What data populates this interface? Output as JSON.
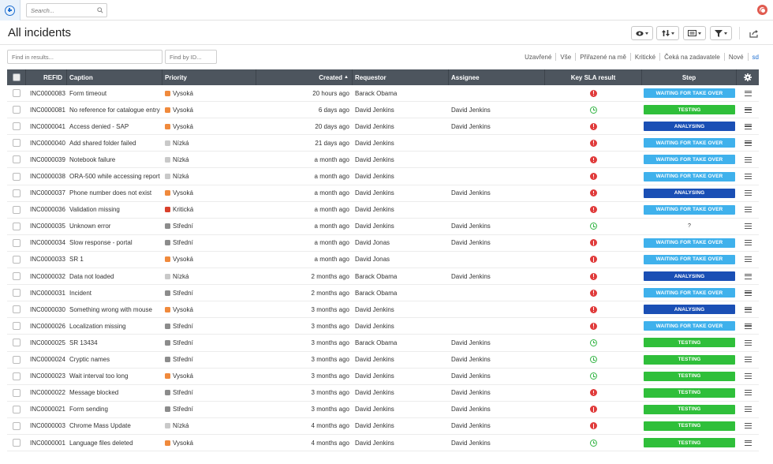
{
  "topbar": {
    "search_placeholder": "Search..."
  },
  "header": {
    "title": "All incidents"
  },
  "filters": {
    "find_results_placeholder": "Find in results...",
    "find_id_placeholder": "Find by ID...",
    "quick": [
      "Uzavřené",
      "Vše",
      "Přiřazené na mě",
      "Kritické",
      "Čeká na zadavatele",
      "Nové",
      "sd"
    ]
  },
  "table": {
    "columns": {
      "refid": "REFID",
      "caption": "Caption",
      "priority": "Priority",
      "created": "Created",
      "requestor": "Requestor",
      "assignee": "Assignee",
      "sla": "Key SLA result",
      "step": "Step"
    },
    "rows": [
      {
        "refid": "INC0000083",
        "caption": "Form timeout",
        "priority": "Vysoká",
        "created": "20 hours ago",
        "requestor": "Barack Obama",
        "assignee": "",
        "sla": "bad",
        "step": "WAITING FOR TAKE OVER"
      },
      {
        "refid": "INC0000081",
        "caption": "No reference for catalogue entry",
        "priority": "Vysoká",
        "created": "6 days ago",
        "requestor": "David Jenkins",
        "assignee": "David Jenkins",
        "sla": "ok",
        "step": "TESTING"
      },
      {
        "refid": "INC0000041",
        "caption": "Access denied - SAP",
        "priority": "Vysoká",
        "created": "20 days ago",
        "requestor": "David Jenkins",
        "assignee": "David Jenkins",
        "sla": "bad",
        "step": "ANALYSING"
      },
      {
        "refid": "INC0000040",
        "caption": "Add shared folder failed",
        "priority": "Nízká",
        "created": "21 days ago",
        "requestor": "David Jenkins",
        "assignee": "",
        "sla": "bad",
        "step": "WAITING FOR TAKE OVER"
      },
      {
        "refid": "INC0000039",
        "caption": "Notebook failure",
        "priority": "Nízká",
        "created": "a month ago",
        "requestor": "David Jenkins",
        "assignee": "",
        "sla": "bad",
        "step": "WAITING FOR TAKE OVER"
      },
      {
        "refid": "INC0000038",
        "caption": "ORA-500 while accessing report",
        "priority": "Nízká",
        "created": "a month ago",
        "requestor": "David Jenkins",
        "assignee": "",
        "sla": "bad",
        "step": "WAITING FOR TAKE OVER"
      },
      {
        "refid": "INC0000037",
        "caption": "Phone number does not exist",
        "priority": "Vysoká",
        "created": "a month ago",
        "requestor": "David Jenkins",
        "assignee": "David Jenkins",
        "sla": "bad",
        "step": "ANALYSING"
      },
      {
        "refid": "INC0000036",
        "caption": "Validation missing",
        "priority": "Kritická",
        "created": "a month ago",
        "requestor": "David Jenkins",
        "assignee": "",
        "sla": "bad",
        "step": "WAITING FOR TAKE OVER"
      },
      {
        "refid": "INC0000035",
        "caption": "Unknown error",
        "priority": "Střední",
        "created": "a month ago",
        "requestor": "David Jenkins",
        "assignee": "David Jenkins",
        "sla": "ok",
        "step": "?"
      },
      {
        "refid": "INC0000034",
        "caption": "Slow response - portal",
        "priority": "Střední",
        "created": "a month ago",
        "requestor": "David Jonas",
        "assignee": "David Jenkins",
        "sla": "bad",
        "step": "WAITING FOR TAKE OVER"
      },
      {
        "refid": "INC0000033",
        "caption": "SR 1",
        "priority": "Vysoká",
        "created": "a month ago",
        "requestor": "David Jonas",
        "assignee": "",
        "sla": "bad",
        "step": "WAITING FOR TAKE OVER"
      },
      {
        "refid": "INC0000032",
        "caption": "Data not loaded",
        "priority": "Nízká",
        "created": "2 months ago",
        "requestor": "Barack Obama",
        "assignee": "David Jenkins",
        "sla": "bad",
        "step": "ANALYSING"
      },
      {
        "refid": "INC0000031",
        "caption": "Incident",
        "priority": "Střední",
        "created": "2 months ago",
        "requestor": "Barack Obama",
        "assignee": "",
        "sla": "bad",
        "step": "WAITING FOR TAKE OVER"
      },
      {
        "refid": "INC0000030",
        "caption": "Something wrong with mouse",
        "priority": "Vysoká",
        "created": "3 months ago",
        "requestor": "David Jenkins",
        "assignee": "",
        "sla": "bad",
        "step": "ANALYSING"
      },
      {
        "refid": "INC0000026",
        "caption": "Localization missing",
        "priority": "Střední",
        "created": "3 months ago",
        "requestor": "David Jenkins",
        "assignee": "",
        "sla": "bad",
        "step": "WAITING FOR TAKE OVER"
      },
      {
        "refid": "INC0000025",
        "caption": "SR 13434",
        "priority": "Střední",
        "created": "3 months ago",
        "requestor": "Barack Obama",
        "assignee": "David Jenkins",
        "sla": "ok",
        "step": "TESTING"
      },
      {
        "refid": "INC0000024",
        "caption": "Cryptic names",
        "priority": "Střední",
        "created": "3 months ago",
        "requestor": "David Jenkins",
        "assignee": "David Jenkins",
        "sla": "ok",
        "step": "TESTING"
      },
      {
        "refid": "INC0000023",
        "caption": "Wait interval too long",
        "priority": "Vysoká",
        "created": "3 months ago",
        "requestor": "David Jenkins",
        "assignee": "David Jenkins",
        "sla": "ok",
        "step": "TESTING"
      },
      {
        "refid": "INC0000022",
        "caption": "Message blocked",
        "priority": "Střední",
        "created": "3 months ago",
        "requestor": "David Jenkins",
        "assignee": "David Jenkins",
        "sla": "bad",
        "step": "TESTING"
      },
      {
        "refid": "INC0000021",
        "caption": "Form sending",
        "priority": "Střední",
        "created": "3 months ago",
        "requestor": "David Jenkins",
        "assignee": "David Jenkins",
        "sla": "bad",
        "step": "TESTING"
      },
      {
        "refid": "INC0000003",
        "caption": "Chrome Mass Update",
        "priority": "Nízká",
        "created": "4 months ago",
        "requestor": "David Jenkins",
        "assignee": "David Jenkins",
        "sla": "bad",
        "step": "TESTING"
      },
      {
        "refid": "INC0000001",
        "caption": "Language files deleted",
        "priority": "Vysoká",
        "created": "4 months ago",
        "requestor": "David Jenkins",
        "assignee": "David Jenkins",
        "sla": "ok",
        "step": "TESTING"
      }
    ]
  },
  "priority_colors": {
    "Vysoká": "#f08a3c",
    "Nízká": "#c9c9c9",
    "Kritická": "#d9402b",
    "Střední": "#8c8c8c"
  },
  "step_colors": {
    "WAITING FOR TAKE OVER": "#3fb1ec",
    "TESTING": "#2fbf3a",
    "ANALYSING": "#1a4fb5"
  },
  "accent_color": "#1f6fd1"
}
